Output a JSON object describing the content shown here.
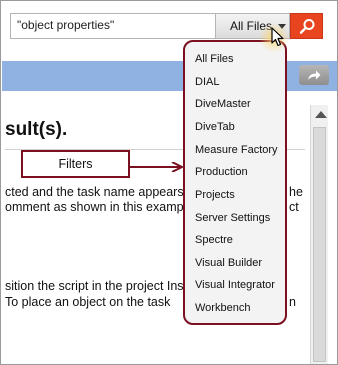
{
  "search": {
    "query": "\"object properties\"",
    "scope_label": "All Files",
    "button_icon": "search-icon"
  },
  "toolbar": {
    "share_icon": "share-arrow-icon"
  },
  "document": {
    "heading": "sult(s).",
    "lines": [
      "cted and the task name appears",
      "omment as shown in this examp",
      "sition the script in the project Ins",
      " To place an object on the task"
    ],
    "right_fragments": [
      "he",
      "ct",
      "n"
    ]
  },
  "callout": {
    "label": "Filters"
  },
  "dropdown": {
    "items": [
      "All Files",
      "DIAL",
      "DiveMaster",
      "DiveTab",
      "Measure Factory",
      "Production",
      "Projects",
      "Server Settings",
      "Spectre",
      "Visual Builder",
      "Visual Integrator",
      "Workbench"
    ]
  },
  "colors": {
    "search_button": "#e8441f",
    "blue_band": "#8fb2e3",
    "callout_border": "#7a1020"
  }
}
